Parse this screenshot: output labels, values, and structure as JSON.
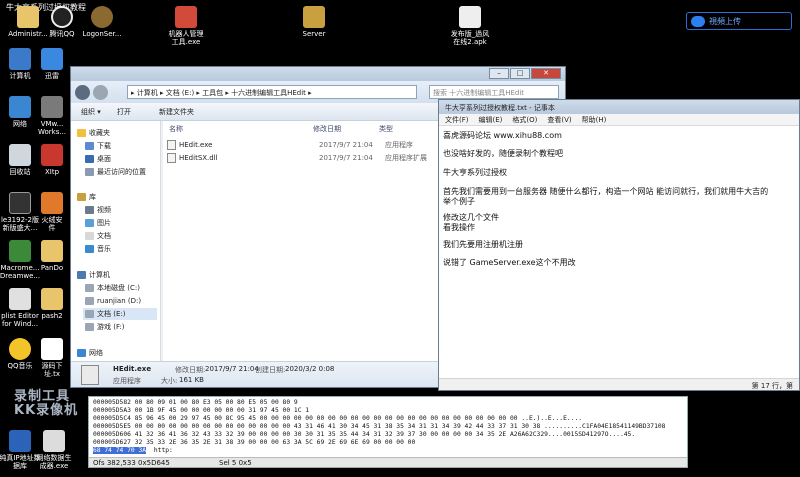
{
  "video_title": "牛大亨系列过授权教程",
  "cloud_upload_label": "視頻上传",
  "desktop_top_icons": [
    {
      "label": "Administr..."
    },
    {
      "label": "腾讯QQ"
    },
    {
      "label": "LogonSer..."
    },
    {
      "label": "机器人管理\n工具.exe"
    },
    {
      "label": "Server"
    },
    {
      "label": "发布版_過风\n在线2.apk"
    }
  ],
  "desktop_left_icons": [
    {
      "label": "计算机"
    },
    {
      "label": "网络"
    },
    {
      "label": "回收站"
    },
    {
      "label": "le3192-2版\n新版盛大..."
    },
    {
      "label": "Macrome...\nDreamwe..."
    },
    {
      "label": "plist Editor\nfor Wind..."
    },
    {
      "label": "QQ音乐"
    },
    {
      "label": "纯真IP地址数\n据库"
    }
  ],
  "desktop_second_col_icons": [
    {
      "label": "迅雷"
    },
    {
      "label": "VMw...\nWorks..."
    },
    {
      "label": "XItp"
    },
    {
      "label": "火绒安\n件"
    },
    {
      "label": "PanDo"
    },
    {
      "label": "pash2"
    },
    {
      "label": "源码下\n址.tx"
    },
    {
      "label": "网络数据生\n成器.exe"
    }
  ],
  "explorer": {
    "address_path": "▸ 计算机 ▸ 文档 (E:) ▸ 工具包 ▸ 十六进制编辑工具HEdit ▸",
    "search_placeholder": "搜索 十六进制编辑工具HEdit",
    "toolbar": {
      "organize": "组织 ▾",
      "open": "打开",
      "new_folder": "新建文件夹"
    },
    "nav": {
      "favorites": "收藏夹",
      "downloads": "下载",
      "desktop": "桌面",
      "recent": "最近访问的位置",
      "libraries": "库",
      "videos": "视频",
      "pictures": "图片",
      "documents": "文档",
      "music": "音乐",
      "computer": "计算机",
      "drive_c": "本地磁盘 (C:)",
      "drive_d": "ruanjian (D:)",
      "drive_e": "文档 (E:)",
      "drive_f": "游戏 (F:)",
      "network": "网络"
    },
    "columns": {
      "name": "名称",
      "modified": "修改日期",
      "type": "类型"
    },
    "files": [
      {
        "name": "HEdit.exe",
        "modified": "2017/9/7 21:04",
        "type": "应用程序"
      },
      {
        "name": "HEditSX.dll",
        "modified": "2017/9/7 21:04",
        "type": "应用程序扩展"
      }
    ],
    "details": {
      "name": "HEdit.exe",
      "modified_label": "修改日期:",
      "modified": "2017/9/7 21:04",
      "created_label": "创建日期:",
      "created": "2020/3/2 0:08",
      "type": "应用程序",
      "size_label": "大小:",
      "size": "161 KB"
    }
  },
  "notepad": {
    "title": "牛大亨系列过授权教程.txt - 记事本",
    "menu": [
      "文件(F)",
      "编辑(E)",
      "格式(O)",
      "查看(V)",
      "帮助(H)"
    ],
    "lines": [
      "喜虎源码论坛 www.xihu88.com",
      "也没啥好发的，随便录制个教程吧",
      "牛大亨系列过授权",
      "首先我们需要用到一台服务器 随便什么都行，构造一个网站 能访问就行，我们就用牛大吉的",
      "举个例子",
      "修改这几个文件",
      "  看我操作",
      "我们先要用注册机注册",
      "说错了 GameServer.exe这个不用改"
    ],
    "status": "第 17 行，第"
  },
  "hexeditor": {
    "rows": [
      "000005D582   00 80 09 01 00 80 E3 05 00 80 E5 05 00 80 9",
      "000005D5A3   00 1B 9F 45 00 00 00 00 00 00 31 97 45 00 1C 1",
      "000005D5C4   85 96 45 00 29 97 45 00 8C 95 45 00 00 00 00 00 00 00 00 00 00 00 00 00 00 00 00 00 00 00 00 00 00 00  ..E.)..E...E....",
      "000005D5E5   00 00 00 00 00 00 00 00 00 00 00 00 00 00 43 31 46 41 30 34 45 31 38 35 34 31 31 34 39 42 44 33 37 31 30 38  ..........C1FA04E18541149BD37108",
      "000005D606   41 32 36 41 36 32 43 33 32 39 00 00 00 00 30 30 31 35 35 44 34 31 32 39 37 30 00 00 00 00 34 35 2E  A26A62C329....0015SD41297O....45.",
      "000005D627   32 35 33 2E 36 35 2E 31 38 39 00 00 00 63 3A 5C 69 2E 69 6E 69 00 00 00 00",
      "000005D627b  68 74 74 70 3A 2F 2F 77  253.65.189...c:\\i.ini....http://w"
    ],
    "selected_hex": "68 74 74 70 3A",
    "selected_text": "http:",
    "status_offset": "Ofs 382,533 0x5D645",
    "status_sel": "Sel 5 0x5"
  },
  "watermark": {
    "line1": "录制工具",
    "line2": "KK录像机"
  }
}
